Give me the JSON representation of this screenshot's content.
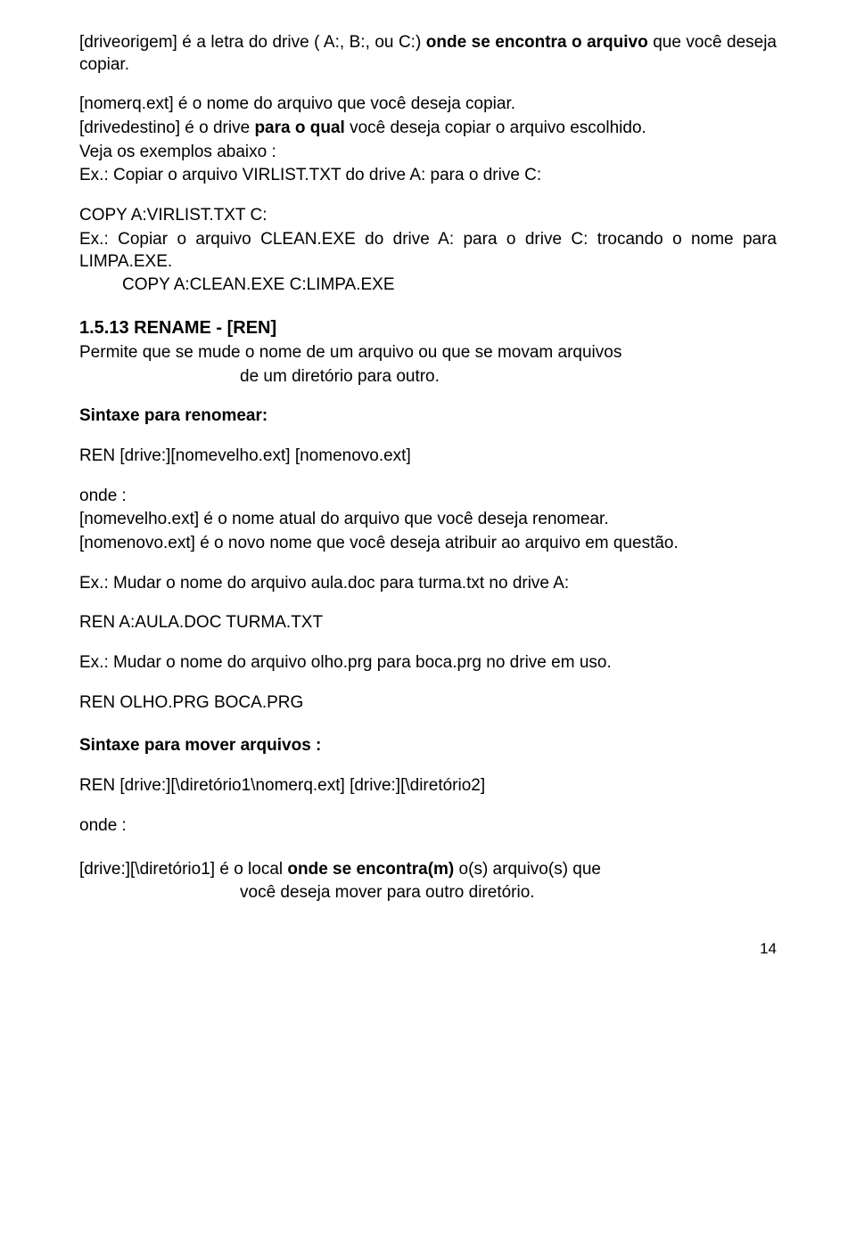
{
  "p1a": "[driveorigem] é a letra do drive (  A:,  B:,  ou  C:)  ",
  "p1b": "onde  se encontra o arquivo",
  "p1c": " que você deseja copiar.",
  "p2a": "[nomerq.ext] é o nome do arquivo que você deseja copiar.",
  "p3a": "[drivedestino] é o drive ",
  "p3b": "para o qual",
  "p3c": " você deseja copiar o arquivo escolhido.",
  "p4": "Veja os exemplos abaixo :",
  "p5": "Ex.: Copiar  o arquivo VIRLIST.TXT do drive A: para o drive C:",
  "p6": "COPY A:VIRLIST.TXT C:",
  "p7a": "Ex.: Copiar  o arquivo CLEAN.EXE do drive  A:  para  o  drive  C: trocando o nome para LIMPA.EXE.",
  "p7b": "COPY A:CLEAN.EXE C:LIMPA.EXE",
  "h1": "1.5.13  RENAME - [REN]",
  "p8a": "Permite que se mude o nome de um arquivo ou   que   se movam arquivos",
  "p8b": "de  um   diretório para outro.",
  "p9": "Sintaxe para renomear:",
  "p10": "REN [drive:][nomevelho.ext] [nomenovo.ext]",
  "p11": "onde :",
  "p12": "[nomevelho.ext] é o nome atual do arquivo que você deseja renomear.",
  "p13": "[nomenovo.ext] é o novo nome que você deseja atribuir ao  arquivo em questão.",
  "p14": "Ex.: Mudar  o nome do arquivo aula.doc para turma.txt no drive A:",
  "p15": "REN A:AULA.DOC TURMA.TXT",
  "p16": "Ex.: Mudar  o nome do arquivo olho.prg para boca.prg no drive  em uso.",
  "p17": " REN OLHO.PRG BOCA.PRG",
  "p18": "Sintaxe para mover arquivos :",
  "p19": " REN  [drive:][\\diretório1\\nomerq.ext] [drive:][\\diretório2]",
  "p20": "onde :",
  "p21a": "[drive:][\\diretório1] é o local ",
  "p21b": "onde se encontra(m)",
  "p21c": " o(s) arquivo(s) que",
  "p21d": "você deseja mover para  outro diretório.",
  "pagenum": "14"
}
